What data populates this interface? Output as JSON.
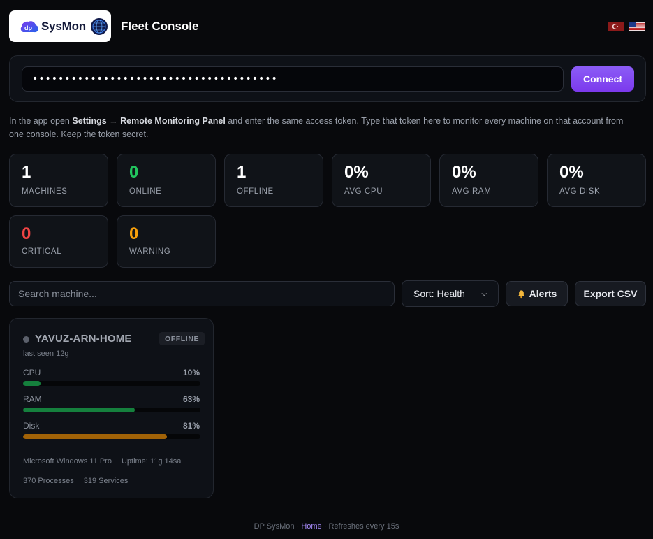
{
  "header": {
    "logo_text": "SysMon",
    "app_title": "Fleet Console",
    "languages": [
      {
        "code": "tr",
        "label": "Türkçe"
      },
      {
        "code": "en",
        "label": "English"
      }
    ]
  },
  "token": {
    "value": "••••••••••••••••••••••••••••••••••••••",
    "connect_label": "Connect"
  },
  "hint": {
    "part1": "In the app open ",
    "bold1": "Settings → Remote Monitoring Panel",
    "part2": " and enter the same access token. Type that token here to monitor every machine on that account from one console. Keep the token secret."
  },
  "stats": [
    {
      "value": "1",
      "label": "MACHINES"
    },
    {
      "value": "0",
      "label": "ONLINE"
    },
    {
      "value": "1",
      "label": "OFFLINE"
    },
    {
      "value": "0%",
      "label": "AVG CPU"
    },
    {
      "value": "0%",
      "label": "AVG RAM"
    },
    {
      "value": "0%",
      "label": "AVG DISK"
    },
    {
      "value": "0",
      "label": "CRITICAL"
    },
    {
      "value": "0",
      "label": "WARNING"
    }
  ],
  "toolbar": {
    "search_placeholder": "Search machine...",
    "sort_label": "Sort: Health",
    "alerts_label": "Alerts",
    "export_label": "Export CSV"
  },
  "machines": [
    {
      "name": "YAVUZ-ARN-HOME",
      "status": "OFFLINE",
      "last_seen": "last seen 12g",
      "metrics": [
        {
          "label": "CPU",
          "value": "10%",
          "fraction": 0.1,
          "color": "#15803d"
        },
        {
          "label": "RAM",
          "value": "63%",
          "fraction": 0.63,
          "color": "#15803d"
        },
        {
          "label": "Disk",
          "value": "81%",
          "fraction": 0.81,
          "color": "#a16207"
        }
      ],
      "os": "Microsoft Windows 11 Pro",
      "uptime": "Uptime: 11g 14sa",
      "processes": "370 Processes",
      "services": "319 Services"
    }
  ],
  "footer": {
    "brand": "DP SysMon · ",
    "home_link": "Home",
    "refresh": " · Refreshes every 15s"
  },
  "colors": {
    "accent": "#7c3aed",
    "online": "#22c55e",
    "critical": "#ef4444",
    "warning": "#f59e0b"
  }
}
